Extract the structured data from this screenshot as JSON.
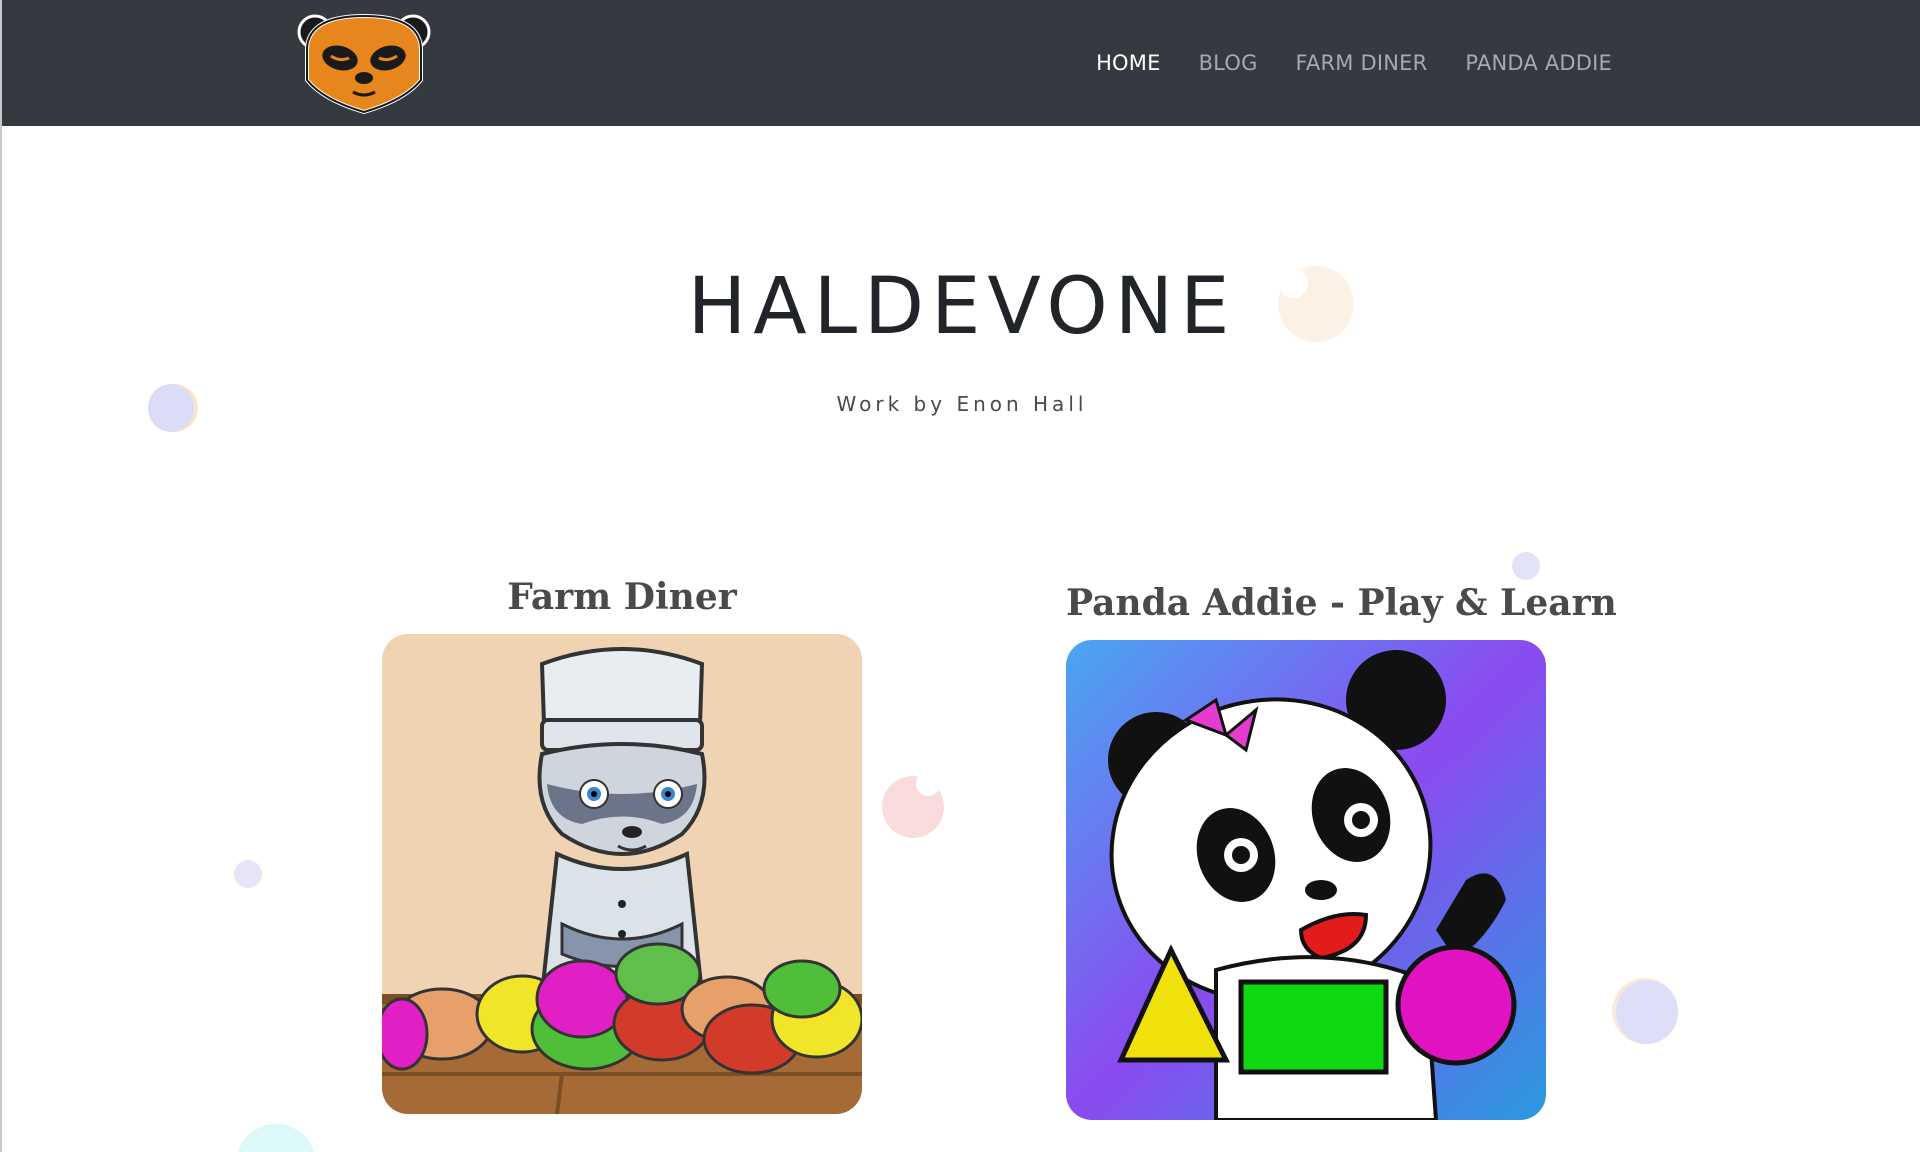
{
  "navbar": {
    "logo_alt": "panda-logo",
    "links": [
      {
        "label": "HOME",
        "active": true
      },
      {
        "label": "BLOG",
        "active": false
      },
      {
        "label": "FARM DINER",
        "active": false
      },
      {
        "label": "PANDA ADDIE",
        "active": false
      }
    ]
  },
  "hero": {
    "title": "HALDEVONE",
    "subtitle": "Work by Enon Hall"
  },
  "cards": [
    {
      "title": "Farm Diner",
      "icon": "raccoon-chef-icon"
    },
    {
      "title": "Panda Addie - Play & Learn",
      "icon": "panda-shapes-icon"
    }
  ],
  "colors": {
    "navbar_bg": "#343a40",
    "nav_active": "#ffffff",
    "nav_inactive": "#a7a9ac",
    "title_text": "#212529"
  }
}
